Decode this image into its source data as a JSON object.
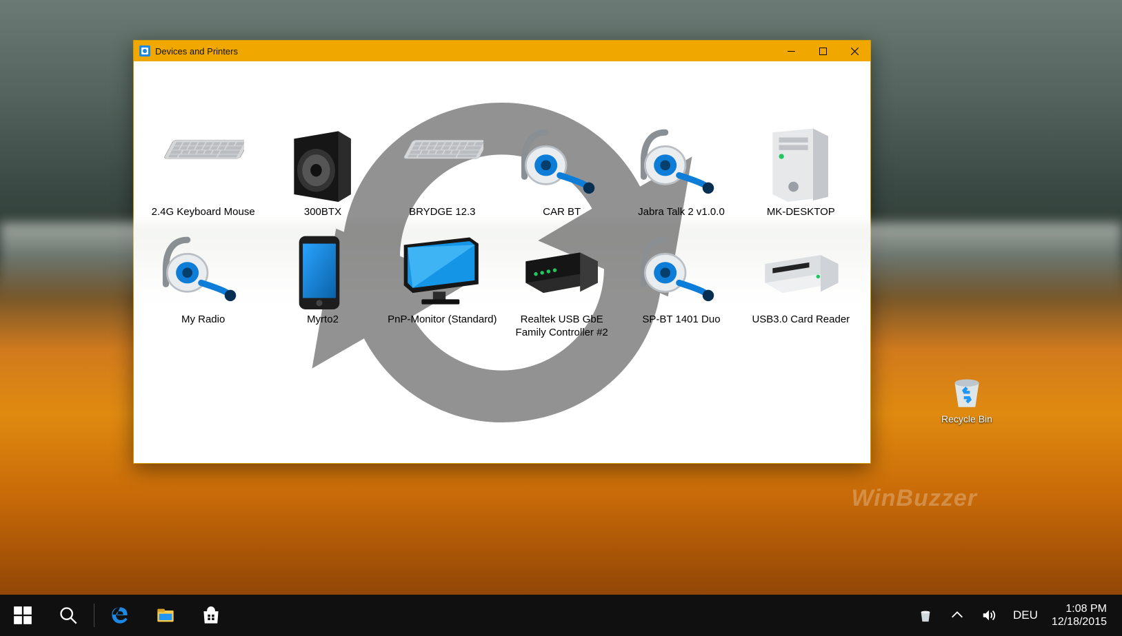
{
  "window": {
    "title": "Devices and Printers"
  },
  "devices": [
    {
      "label": "2.4G Keyboard Mouse",
      "icon": "keyboard"
    },
    {
      "label": "300BTX",
      "icon": "speaker"
    },
    {
      "label": "BRYDGE 12.3",
      "icon": "keyboard"
    },
    {
      "label": "CAR BT",
      "icon": "headset"
    },
    {
      "label": "Jabra Talk 2 v1.0.0",
      "icon": "headset"
    },
    {
      "label": "MK-DESKTOP",
      "icon": "tower"
    },
    {
      "label": "My Radio",
      "icon": "headset"
    },
    {
      "label": "Myrto2",
      "icon": "phone"
    },
    {
      "label": "PnP-Monitor (Standard)",
      "icon": "monitor"
    },
    {
      "label": "Realtek USB GbE Family Controller #2",
      "icon": "hub"
    },
    {
      "label": "SP-BT 1401 Duo",
      "icon": "headset"
    },
    {
      "label": "USB3.0 Card Reader",
      "icon": "reader"
    }
  ],
  "desktop": {
    "recyclebin_label": "Recycle Bin"
  },
  "taskbar": {
    "lang": "DEU",
    "time": "1:08 PM",
    "date": "12/18/2015"
  },
  "watermark": "WinBuzzer"
}
